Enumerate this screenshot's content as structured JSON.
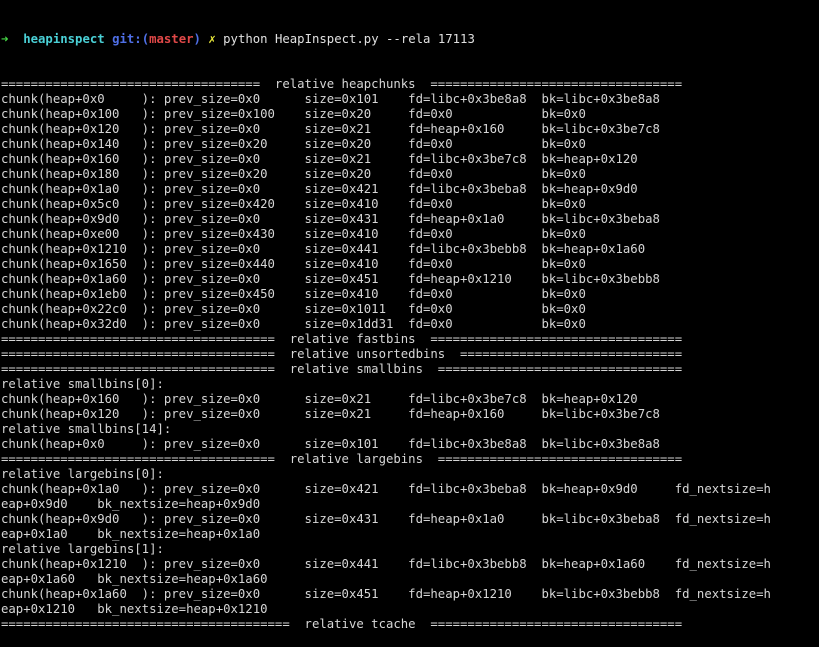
{
  "prompt": {
    "arrow": "➜",
    "directory": "heapinspect",
    "git_label": "git:",
    "paren_open": "(",
    "branch": "master",
    "paren_close": ")",
    "dirty_marker": "✗",
    "command": "python HeapInspect.py --rela 17113"
  },
  "colors": {
    "background": "#000000",
    "text": "#d6d6d6",
    "arrow": "#46d746",
    "directory": "#4ad0d6",
    "git_label": "#4f6fe6",
    "branch": "#e04848",
    "dirty_marker": "#e8e83a"
  },
  "output_lines": [
    "===================================  relative heapchunks  ==================================",
    "chunk(heap+0x0     ): prev_size=0x0      size=0x101    fd=libc+0x3be8a8  bk=libc+0x3be8a8",
    "chunk(heap+0x100   ): prev_size=0x100    size=0x20     fd=0x0            bk=0x0",
    "chunk(heap+0x120   ): prev_size=0x0      size=0x21     fd=heap+0x160     bk=libc+0x3be7c8",
    "chunk(heap+0x140   ): prev_size=0x20     size=0x20     fd=0x0            bk=0x0",
    "chunk(heap+0x160   ): prev_size=0x0      size=0x21     fd=libc+0x3be7c8  bk=heap+0x120",
    "chunk(heap+0x180   ): prev_size=0x20     size=0x20     fd=0x0            bk=0x0",
    "chunk(heap+0x1a0   ): prev_size=0x0      size=0x421    fd=libc+0x3beba8  bk=heap+0x9d0",
    "chunk(heap+0x5c0   ): prev_size=0x420    size=0x410    fd=0x0            bk=0x0",
    "chunk(heap+0x9d0   ): prev_size=0x0      size=0x431    fd=heap+0x1a0     bk=libc+0x3beba8",
    "chunk(heap+0xe00   ): prev_size=0x430    size=0x410    fd=0x0            bk=0x0",
    "chunk(heap+0x1210  ): prev_size=0x0      size=0x441    fd=libc+0x3bebb8  bk=heap+0x1a60",
    "chunk(heap+0x1650  ): prev_size=0x440    size=0x410    fd=0x0            bk=0x0",
    "chunk(heap+0x1a60  ): prev_size=0x0      size=0x451    fd=heap+0x1210    bk=libc+0x3bebb8",
    "chunk(heap+0x1eb0  ): prev_size=0x450    size=0x410    fd=0x0            bk=0x0",
    "chunk(heap+0x22c0  ): prev_size=0x0      size=0x1011   fd=0x0            bk=0x0",
    "chunk(heap+0x32d0  ): prev_size=0x0      size=0x1dd31  fd=0x0            bk=0x0",
    "=====================================  relative fastbins  ==================================",
    "=====================================  relative unsortedbins  ==============================",
    "=====================================  relative smallbins  =================================",
    "relative smallbins[0]:",
    "chunk(heap+0x160   ): prev_size=0x0      size=0x21     fd=libc+0x3be7c8  bk=heap+0x120",
    "chunk(heap+0x120   ): prev_size=0x0      size=0x21     fd=heap+0x160     bk=libc+0x3be7c8",
    "relative smallbins[14]:",
    "chunk(heap+0x0     ): prev_size=0x0      size=0x101    fd=libc+0x3be8a8  bk=libc+0x3be8a8",
    "=====================================  relative largebins  =================================",
    "relative largebins[0]:",
    "chunk(heap+0x1a0   ): prev_size=0x0      size=0x421    fd=libc+0x3beba8  bk=heap+0x9d0     fd_nextsize=h",
    "eap+0x9d0    bk_nextsize=heap+0x9d0",
    "chunk(heap+0x9d0   ): prev_size=0x0      size=0x431    fd=heap+0x1a0     bk=libc+0x3beba8  fd_nextsize=h",
    "eap+0x1a0    bk_nextsize=heap+0x1a0",
    "relative largebins[1]:",
    "chunk(heap+0x1210  ): prev_size=0x0      size=0x441    fd=libc+0x3bebb8  bk=heap+0x1a60    fd_nextsize=h",
    "eap+0x1a60   bk_nextsize=heap+0x1a60",
    "chunk(heap+0x1a60  ): prev_size=0x0      size=0x451    fd=heap+0x1210    bk=libc+0x3bebb8  fd_nextsize=h",
    "eap+0x1210   bk_nextsize=heap+0x1210",
    "=======================================  relative tcache  =================================="
  ]
}
